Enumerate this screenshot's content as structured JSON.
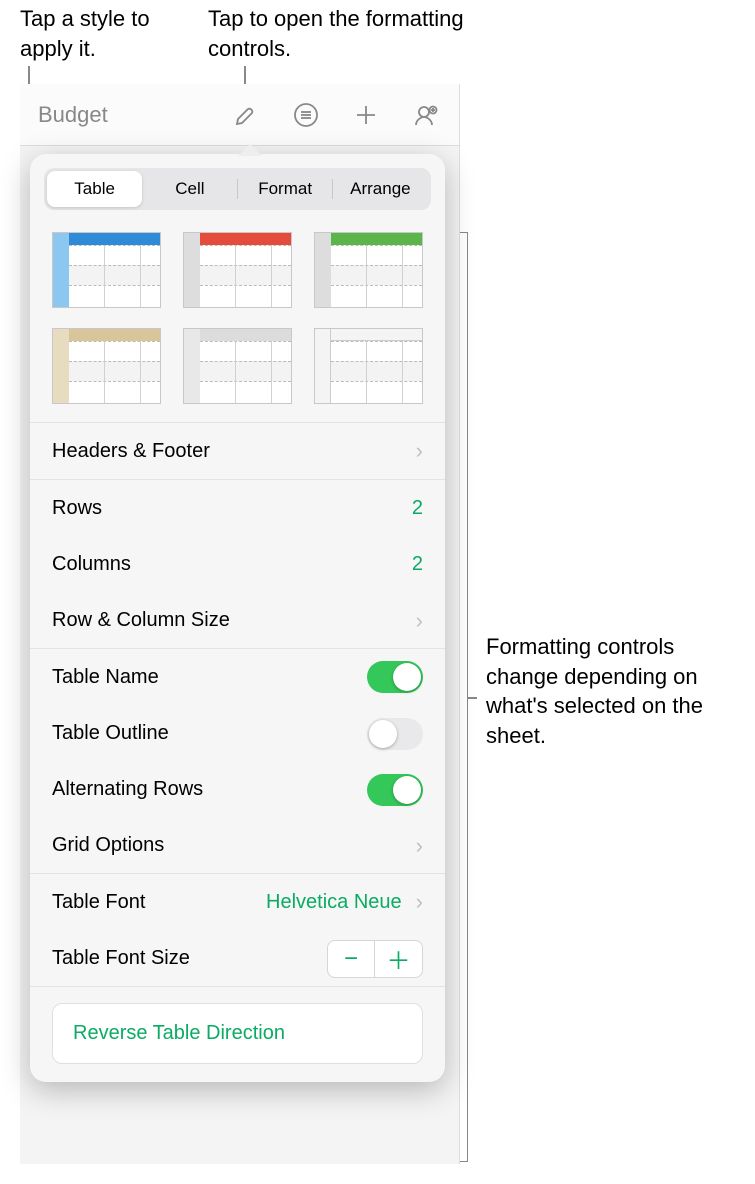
{
  "callouts": {
    "style": "Tap a style to apply it.",
    "format_btn": "Tap to open the formatting controls.",
    "panel": "Formatting controls change depending on what's selected on the sheet."
  },
  "toolbar": {
    "doc_title": "Budget"
  },
  "tabs": {
    "table": "Table",
    "cell": "Cell",
    "format": "Format",
    "arrange": "Arrange"
  },
  "styles": [
    {
      "id": "blue"
    },
    {
      "id": "red"
    },
    {
      "id": "green"
    },
    {
      "id": "tan"
    },
    {
      "id": "grey"
    },
    {
      "id": "white"
    }
  ],
  "rows": {
    "headers_footer": "Headers & Footer",
    "rows_label": "Rows",
    "rows_value": "2",
    "cols_label": "Columns",
    "cols_value": "2",
    "rc_size": "Row & Column Size",
    "table_name": "Table Name",
    "table_outline": "Table Outline",
    "alt_rows": "Alternating Rows",
    "grid_options": "Grid Options",
    "table_font": "Table Font",
    "table_font_value": "Helvetica Neue",
    "table_font_size": "Table Font Size",
    "reverse": "Reverse Table Direction"
  },
  "toggles": {
    "table_name": true,
    "table_outline": false,
    "alt_rows": true
  },
  "glyphs": {
    "chevron": "›",
    "minus": "−",
    "plus": "＋"
  }
}
